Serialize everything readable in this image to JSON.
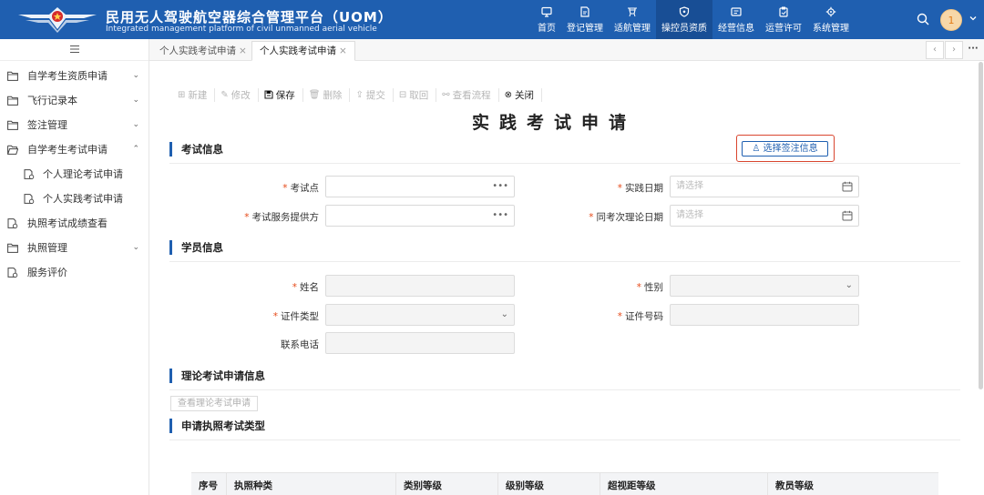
{
  "header": {
    "title_cn": "民用无人驾驶航空器综合管理平台（UOM）",
    "title_en": "Integrated management platform of civil unmanned aerial vehicle",
    "avatar_text": "1",
    "colors": {
      "bar": "#1f5fb0",
      "active": "#184e95"
    },
    "nav": [
      {
        "label": "首页",
        "icon": "monitor-icon"
      },
      {
        "label": "登记管理",
        "icon": "register-icon"
      },
      {
        "label": "适航管理",
        "icon": "drone-icon"
      },
      {
        "label": "操控员资质",
        "icon": "shield-icon",
        "active": true
      },
      {
        "label": "经营信息",
        "icon": "info-card-icon"
      },
      {
        "label": "运营许可",
        "icon": "permit-icon"
      },
      {
        "label": "系统管理",
        "icon": "gear-icon"
      }
    ]
  },
  "sidebar": {
    "items": [
      {
        "label": "自学考生资质申请",
        "icon": "folder-icon",
        "arrow": "⌄"
      },
      {
        "label": "飞行记录本",
        "icon": "folder-icon",
        "arrow": "⌄"
      },
      {
        "label": "签注管理",
        "icon": "folder-icon",
        "arrow": "⌄"
      },
      {
        "label": "自学考生考试申请",
        "icon": "folder-open-icon",
        "arrow": "⌃"
      },
      {
        "label": "个人理论考试申请",
        "icon": "document-icon",
        "sub": true
      },
      {
        "label": "个人实践考试申请",
        "icon": "document-icon",
        "sub": true
      },
      {
        "label": "执照考试成绩查看",
        "icon": "document-icon"
      },
      {
        "label": "执照管理",
        "icon": "folder-icon",
        "arrow": "⌄"
      },
      {
        "label": "服务评价",
        "icon": "document-icon"
      }
    ]
  },
  "tabs": [
    {
      "label": "个人实践考试申请",
      "close": "×"
    },
    {
      "label": "个人实践考试申请",
      "close": "×",
      "active": true
    }
  ],
  "toolbar": {
    "new": "新建",
    "edit": "修改",
    "save": "保存",
    "delete": "删除",
    "submit": "提交",
    "withdraw": "取回",
    "flow": "查看流程",
    "close": "关闭"
  },
  "page_title": "实践考试申请",
  "exam": {
    "section": "考试信息",
    "pick_button": "选择签注信息",
    "site_label": "考试点",
    "provider_label": "考试服务提供方",
    "date_label": "实践日期",
    "date_placeholder": "请选择",
    "theory_date_label": "同考次理论日期",
    "theory_date_placeholder": "请选择"
  },
  "student": {
    "section": "学员信息",
    "name_label": "姓名",
    "gender_label": "性别",
    "id_type_label": "证件类型",
    "id_no_label": "证件号码",
    "phone_label": "联系电话"
  },
  "theory": {
    "section": "理论考试申请信息",
    "view_button": "查看理论考试申请"
  },
  "license": {
    "section": "申请执照考试类型",
    "columns": [
      "序号",
      "执照种类",
      "类别等级",
      "级别等级",
      "超视距等级",
      "教员等级"
    ]
  }
}
